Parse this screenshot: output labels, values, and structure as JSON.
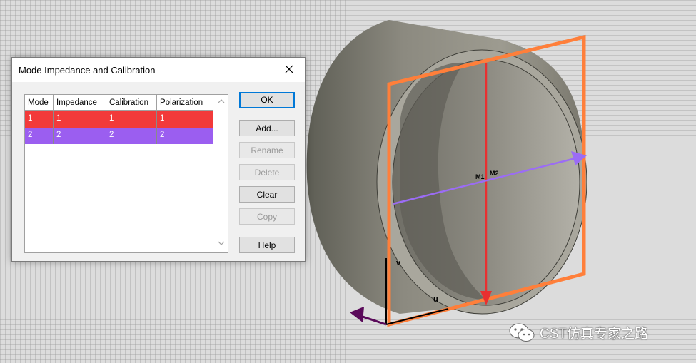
{
  "dialog": {
    "title": "Mode Impedance and Calibration",
    "table": {
      "headers": [
        "Mode",
        "Impedance",
        "Calibration",
        "Polarization"
      ],
      "rows": [
        {
          "cells": [
            "1",
            "1",
            "1",
            "1"
          ],
          "color": "#f23a3a"
        },
        {
          "cells": [
            "2",
            "2",
            "2",
            "2"
          ],
          "color": "#9b5ef0"
        }
      ]
    },
    "buttons": {
      "ok": "OK",
      "add": "Add...",
      "rename": "Rename",
      "delete": "Delete",
      "clear": "Clear",
      "copy": "Copy",
      "help": "Help"
    }
  },
  "viewport": {
    "port_labels": {
      "m1": "M1",
      "m2": "M2",
      "u": "u",
      "v": "v"
    },
    "colors": {
      "port_frame": "#ff7f3a",
      "mode1_arrow": "#e83030",
      "mode2_arrow": "#9b6cf5",
      "origin_arrow": "#5a0a5a"
    }
  },
  "watermark": {
    "text": "CST仿真专家之路",
    "icon": "wechat-icon"
  }
}
